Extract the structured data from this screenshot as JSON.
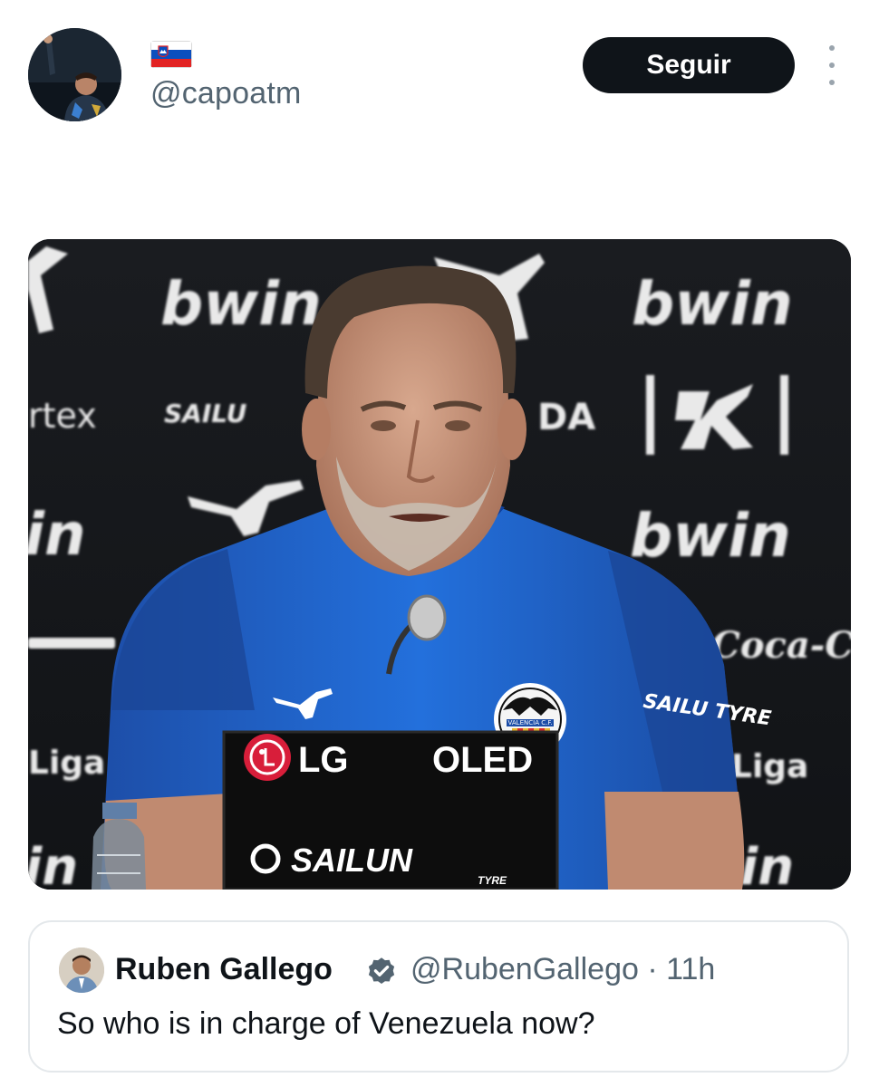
{
  "post": {
    "author": {
      "handle": "@capoatm",
      "avatar_icon": "user-avatar-photo",
      "flag_icon": "slovenia-flag-icon"
    },
    "follow_label": "Seguir",
    "more_icon": "more-options-vertical-icon",
    "media": {
      "type": "photo",
      "background_texts": [
        "bwin",
        "bwin",
        "bwin",
        "bwin",
        "rtex",
        "SAILU",
        "DA",
        "in",
        "in",
        "Liga",
        "Liga",
        "in",
        "Coca-Cola",
        "SAILU TYRE"
      ],
      "sign_brand": "LG",
      "sign_product": "OLED",
      "sign_sponsor": "SAILUN",
      "sign_sponsor_sub": "TYRE",
      "crest_text": "VALENCIA C.F."
    },
    "quoted": {
      "name": "Ruben Gallego",
      "verified_icon": "verified-badge-icon",
      "handle_time": "@RubenGallego · 11h",
      "text": "So who is in charge of Venezuela now?"
    }
  },
  "colors": {
    "follow_bg": "#0f1419",
    "handle_gray": "#536471",
    "verified_blue": "#1d9bf0",
    "shirt_blue": "#1e63c9",
    "backdrop": "#16181c"
  }
}
